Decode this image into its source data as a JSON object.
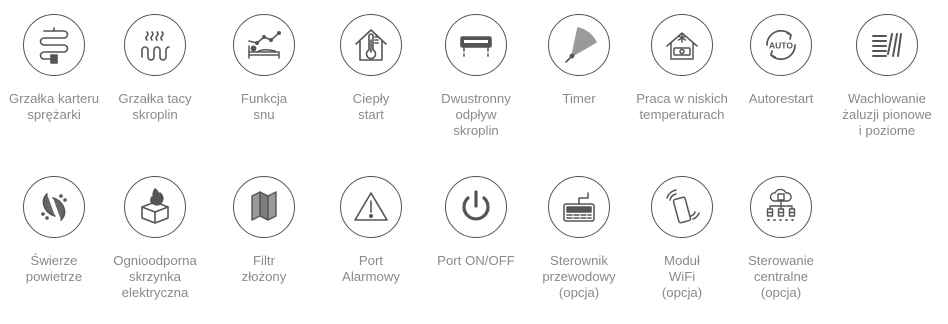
{
  "features": [
    {
      "icon": "compressor-heater-icon",
      "lines": [
        "Grzałka karteru",
        "sprężarki"
      ]
    },
    {
      "icon": "condensate-tray-heater-icon",
      "lines": [
        "Grzałka tacy",
        "skroplin"
      ]
    },
    {
      "icon": "sleep-function-icon",
      "lines": [
        "Funkcja",
        "snu"
      ]
    },
    {
      "icon": "warm-start-icon",
      "lines": [
        "Ciepły",
        "start"
      ]
    },
    {
      "icon": "two-way-drain-icon",
      "lines": [
        "Dwustronny",
        "odpływ",
        "skroplin"
      ]
    },
    {
      "icon": "timer-icon",
      "lines": [
        "Timer"
      ]
    },
    {
      "icon": "low-temperature-operation-icon",
      "lines": [
        "Praca w niskich",
        "temperaturach"
      ]
    },
    {
      "icon": "autorestart-icon",
      "lines": [
        "Autorestart"
      ]
    },
    {
      "icon": "louver-swing-icon",
      "lines": [
        "Wachlowanie",
        "żaluzji pionowe",
        "i poziome"
      ]
    },
    {
      "icon": "fresh-air-icon",
      "lines": [
        "Świerze",
        "powietrze"
      ]
    },
    {
      "icon": "fireproof-box-icon",
      "lines": [
        "Ognioodporna",
        "skrzynka",
        "elektryczna"
      ]
    },
    {
      "icon": "folded-filter-icon",
      "lines": [
        "Filtr",
        "złożony"
      ]
    },
    {
      "icon": "alarm-port-icon",
      "lines": [
        "Port",
        "Alarmowy"
      ]
    },
    {
      "icon": "power-port-icon",
      "lines": [
        "Port ON/OFF"
      ]
    },
    {
      "icon": "wired-controller-icon",
      "lines": [
        "Sterownik",
        "przewodowy",
        "(opcja)"
      ]
    },
    {
      "icon": "wifi-module-icon",
      "lines": [
        "Moduł",
        "WiFi",
        "(opcja)"
      ]
    },
    {
      "icon": "central-control-icon",
      "lines": [
        "Sterowanie",
        "centralne",
        "(opcja)"
      ]
    }
  ],
  "icon_text": {
    "auto": "AUTO"
  },
  "colors": {
    "icon_stroke": "#555555",
    "label": "#8a8a8a",
    "accent_fill": "#9a9a9a"
  }
}
